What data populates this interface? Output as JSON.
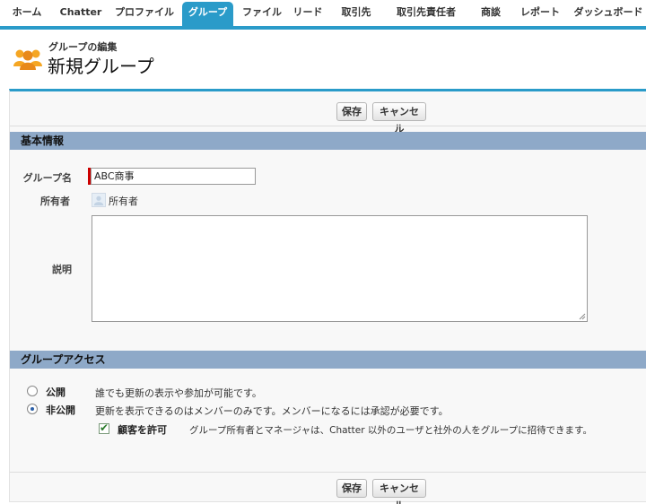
{
  "tabs": [
    {
      "label": "ホーム",
      "active": false
    },
    {
      "label": "Chatter",
      "active": false
    },
    {
      "label": "プロファイル",
      "active": false
    },
    {
      "label": "グループ",
      "active": true
    },
    {
      "label": "ファイル",
      "active": false
    },
    {
      "label": "リード",
      "active": false
    },
    {
      "label": "取引先",
      "active": false
    },
    {
      "label": "取引先責任者",
      "active": false
    },
    {
      "label": "商談",
      "active": false
    },
    {
      "label": "レポート",
      "active": false
    },
    {
      "label": "ダッシュボード",
      "active": false
    }
  ],
  "header": {
    "subtitle": "グループの編集",
    "title": "新規グループ",
    "icon": "group-icon"
  },
  "buttons": {
    "save": "保存",
    "cancel": "キャンセル"
  },
  "basic_info": {
    "heading": "基本情報",
    "group_name_label": "グループ名",
    "group_name_value": "ABC商事",
    "owner_label": "所有者",
    "owner_value": "所有者",
    "description_label": "説明",
    "description_value": ""
  },
  "access": {
    "heading": "グループアクセス",
    "public_label": "公開",
    "public_desc": "誰でも更新の表示や参加が可能です。",
    "private_label": "非公開",
    "private_desc": "更新を表示できるのはメンバーのみです。メンバーになるには承認が必要です。",
    "selected": "private",
    "allow_customers_label": "顧客を許可",
    "allow_customers_checked": true,
    "allow_customers_desc": "グループ所有者とマネージャは、Chatter 以外のユーザと社外の人をグループに招待できます。"
  },
  "colors": {
    "accent": "#2a9bc9",
    "section_header": "#8ea9c8",
    "required": "#cc0000"
  }
}
